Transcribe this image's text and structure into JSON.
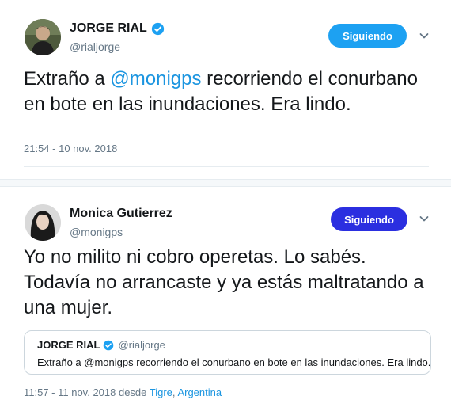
{
  "tweet1": {
    "display_name": "JORGE RIAL",
    "handle": "@rialjorge",
    "follow_label": "Siguiendo",
    "text_before": "Extraño a ",
    "mention": "@monigps",
    "text_after": " recorriendo el conurbano en bote en las inundaciones. Era lindo.",
    "timestamp": "21:54 - 10 nov. 2018"
  },
  "tweet2": {
    "display_name": "Monica Gutierrez",
    "handle": "@monigps",
    "follow_label": "Siguiendo",
    "text": "Yo no milito ni cobro operetas. Lo sabés. Todavía no arrancaste y ya estás maltratando a una mujer.",
    "quote": {
      "display_name": "JORGE RIAL",
      "handle": "@rialjorge",
      "text": "Extraño a @monigps recorriendo el conurbano en bote en las inundaciones. Era lindo."
    },
    "timestamp_prefix": "11:57 - 11 nov. 2018 desde ",
    "place_city": "Tigre",
    "place_sep": ", ",
    "place_country": "Argentina"
  },
  "colors": {
    "twitter_blue": "#1da1f2",
    "follow_blue_dark": "#2b2fe0",
    "mention_blue": "#1b95e0",
    "secondary_text": "#657786"
  },
  "icons": [
    "verified-badge-icon",
    "chevron-down-icon"
  ]
}
